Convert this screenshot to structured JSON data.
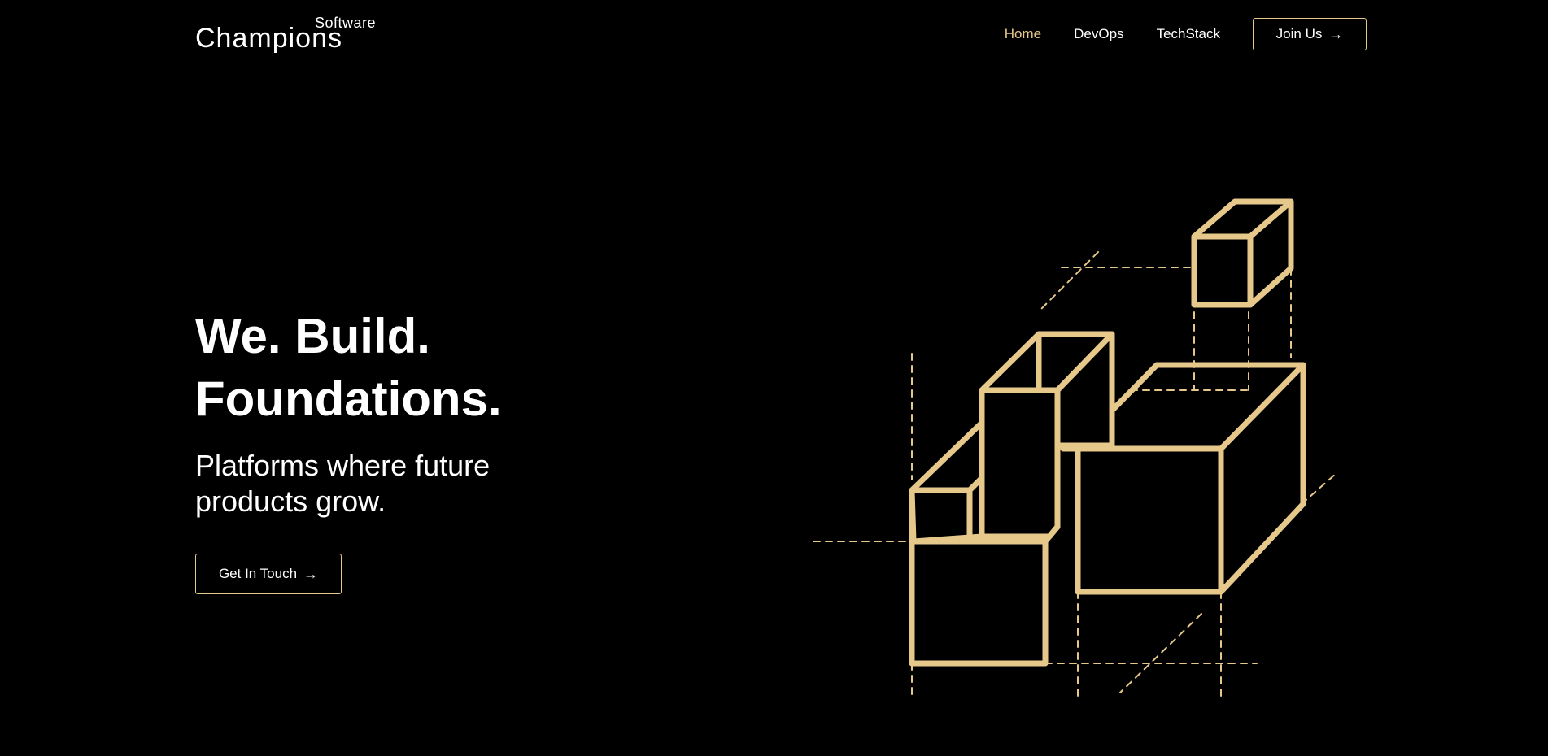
{
  "brand": {
    "logo_top": "Software",
    "logo_main": "Champions"
  },
  "nav": {
    "items": [
      {
        "label": "Home",
        "active": true
      },
      {
        "label": "DevOps",
        "active": false
      },
      {
        "label": "TechStack",
        "active": false
      }
    ],
    "join_label": "Join Us",
    "arrow_icon": "arrow-right-icon"
  },
  "hero": {
    "title_line1": "We. Build.",
    "title_line2": "Foundations.",
    "subtitle": "Platforms where future products grow.",
    "cta_label": "Get In Touch"
  },
  "colors": {
    "background": "#000000",
    "accent": "#e6c88a",
    "text": "#ffffff"
  },
  "illustration": {
    "icon": "isometric-boxes-illustration"
  }
}
